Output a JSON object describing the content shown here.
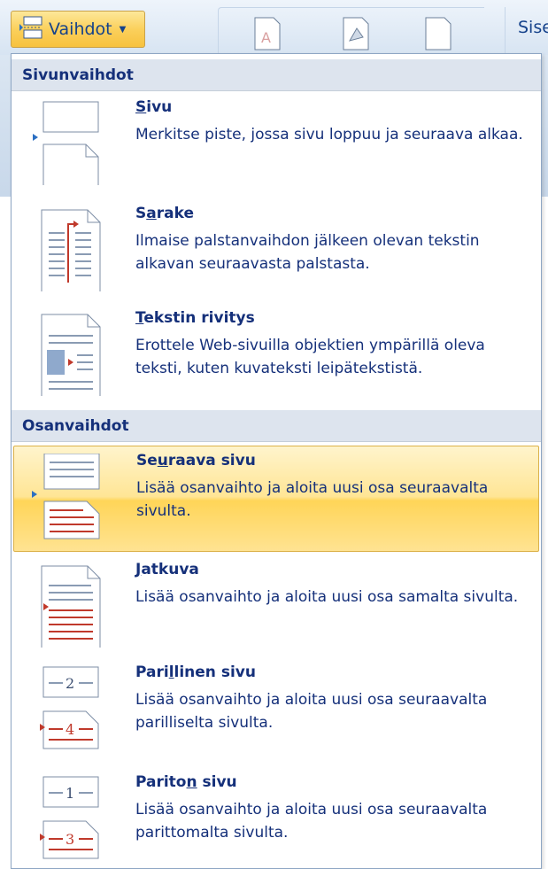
{
  "ribbon": {
    "breaks_button": {
      "label": "Vaihdot",
      "icon": "page-break-icon"
    },
    "other_tab_label": "Sise"
  },
  "menu": {
    "sections": [
      {
        "header": "Sivunvaihdot",
        "items": [
          {
            "title_pre": "",
            "title_key": "S",
            "title_post": "ivu",
            "description": "Merkitse piste, jossa sivu loppuu ja seuraava alkaa.",
            "icon": "page-break-icon"
          },
          {
            "title_pre": "S",
            "title_key": "a",
            "title_post": "rake",
            "description": "Ilmaise palstanvaihdon jälkeen olevan tekstin alkavan seuraavasta palstasta.",
            "icon": "column-break-icon"
          },
          {
            "title_pre": "",
            "title_key": "T",
            "title_post": "ekstin rivitys",
            "description": "Erottele Web-sivuilla objektien ympärillä oleva teksti, kuten kuvateksti leipätekstistä.",
            "icon": "text-wrapping-break-icon"
          }
        ]
      },
      {
        "header": "Osanvaihdot",
        "items": [
          {
            "title_pre": "Se",
            "title_key": "u",
            "title_post": "raava sivu",
            "description": "Lisää osanvaihto ja aloita uusi osa seuraavalta sivulta.",
            "icon": "next-page-section-icon",
            "highlighted": true
          },
          {
            "title_pre": "",
            "title_key": "J",
            "title_post": "atkuva",
            "description": "Lisää osanvaihto ja aloita uusi osa samalta sivulta.",
            "icon": "continuous-section-icon"
          },
          {
            "title_pre": "Pari",
            "title_key": "l",
            "title_post": "linen sivu",
            "description": "Lisää osanvaihto ja aloita uusi osa seuraavalta parilliselta sivulta.",
            "icon": "even-page-section-icon",
            "page_numbers": [
              "2",
              "4"
            ]
          },
          {
            "title_pre": "Parito",
            "title_key": "n",
            "title_post": " sivu",
            "description": "Lisää osanvaihto ja aloita uusi osa seuraavalta parittomalta sivulta.",
            "icon": "odd-page-section-icon",
            "page_numbers": [
              "1",
              "3"
            ]
          }
        ]
      }
    ]
  },
  "colors": {
    "text": "#15307a",
    "header_bg": "#dde4ee",
    "hover_bg": "#ffe595",
    "accent_red": "#c0392b"
  }
}
